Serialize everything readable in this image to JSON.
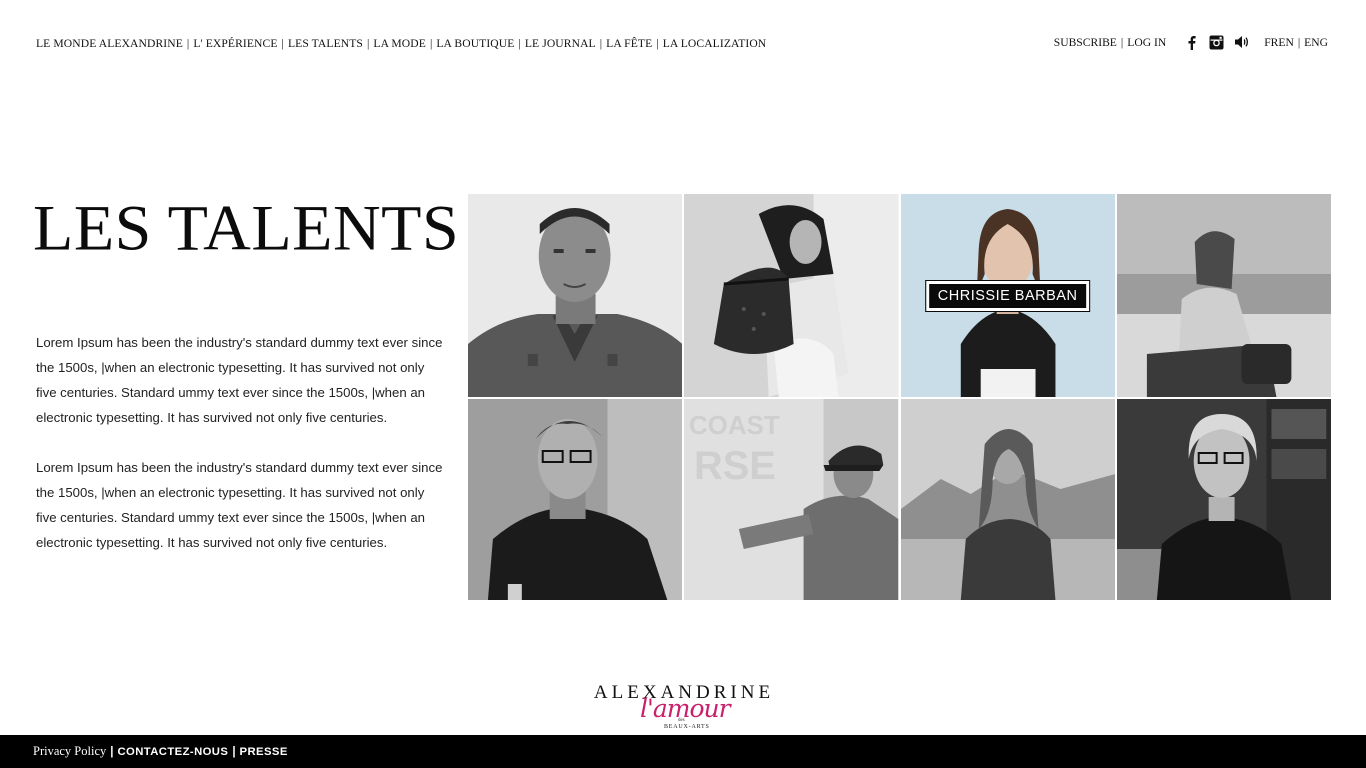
{
  "nav": {
    "items": [
      {
        "label": "LE MONDE ALEXANDRINE"
      },
      {
        "label": "L' EXPÉRIENCE"
      },
      {
        "label": "LES TALENTS"
      },
      {
        "label": "LA MODE"
      },
      {
        "label": "LA BOUTIQUE"
      },
      {
        "label": "LE JOURNAL"
      },
      {
        "label": "LA FÊTE"
      },
      {
        "label": "LA LOCALIZATION"
      }
    ],
    "separator": "|"
  },
  "account": {
    "subscribe": "SUBSCRIBE",
    "login": "LOG IN",
    "separator": "|"
  },
  "social": {
    "icons": [
      "facebook-icon",
      "instagram-icon",
      "sound-icon"
    ]
  },
  "language": {
    "fren": "FREN",
    "eng": "ENG",
    "separator": "|"
  },
  "page": {
    "title": "LES TALENTS",
    "paragraphs": [
      "Lorem Ipsum has been the industry's standard dummy text ever since the 1500s, |when an electronic typesetting. It has survived not only five centuries. Standard ummy text ever since the 1500s, |when an electronic typesetting. It has survived not only five centuries.",
      "Lorem Ipsum has been the industry's standard dummy text ever since the 1500s, |when an electronic typesetting. It has survived not only five centuries. Standard ummy text ever since the 1500s, |when an electronic typesetting. It has survived not only five centuries."
    ]
  },
  "talents": {
    "hover_label": "CHRISSIE BARBAN",
    "tiles": [
      {
        "photo": "man-denim-shirt-portrait"
      },
      {
        "photo": "woman-with-handbag"
      },
      {
        "photo": "woman-lace-top-color",
        "label": "CHRISSIE BARBAN"
      },
      {
        "photo": "woman-on-sofa"
      },
      {
        "photo": "man-with-glasses"
      },
      {
        "photo": "man-painting-wall"
      },
      {
        "photo": "woman-desert"
      },
      {
        "photo": "woman-glasses-bookshelf"
      }
    ]
  },
  "logo": {
    "wordmark": "ALEXANDRINE",
    "script": "l'amour",
    "des": "des",
    "beaux_arts": "BEAUX-ARTS",
    "accent_color": "#c8206b"
  },
  "footer": {
    "privacy": "Privacy Policy",
    "contact": "CONTACTEZ-NOUS",
    "presse": "PRESSE",
    "separator": "|"
  }
}
